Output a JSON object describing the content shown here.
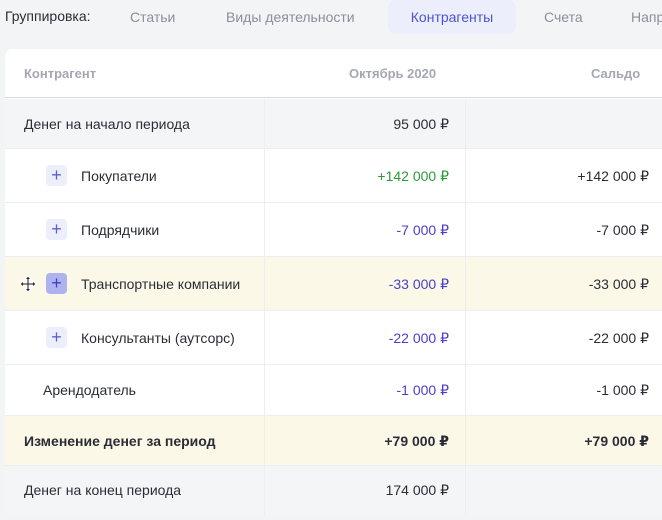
{
  "toolbar": {
    "grouping_label": "Группировка:",
    "tabs": [
      {
        "label": "Статьи",
        "active": false
      },
      {
        "label": "Виды деятельности",
        "active": false
      },
      {
        "label": "Контрагенты",
        "active": true
      },
      {
        "label": "Счета",
        "active": false
      },
      {
        "label": "Напр",
        "active": false
      }
    ]
  },
  "table": {
    "headers": {
      "counterparty": "Контрагент",
      "period": "Октябрь 2020",
      "balance": "Сальдо"
    },
    "rows": [
      {
        "name": "Денег на начало периода",
        "value": "95 000 ₽",
        "balance": ""
      },
      {
        "name": "Покупатели",
        "value": "+142 000 ₽",
        "balance": "+142 000 ₽"
      },
      {
        "name": "Подрядчики",
        "value": "-7 000 ₽",
        "balance": "-7 000 ₽"
      },
      {
        "name": "Транспортные компании",
        "value": "-33 000 ₽",
        "balance": "-33 000 ₽"
      },
      {
        "name": "Консультанты (аутсорс)",
        "value": "-22 000 ₽",
        "balance": "-22 000 ₽"
      },
      {
        "name": "Арендодатель",
        "value": "-1 000 ₽",
        "balance": "-1 000 ₽"
      },
      {
        "name": "Изменение денег за период",
        "value": "+79 000 ₽",
        "balance": "+79 000 ₽"
      },
      {
        "name": "Денег на конец периода",
        "value": "174 000 ₽",
        "balance": ""
      }
    ]
  },
  "colors": {
    "positive": "#2e9a3a",
    "negative": "#4a3fc9",
    "accent": "#4a55d1",
    "highlight_row": "#fcf8e8"
  },
  "icons": {
    "expand": "+",
    "move_cursor": "move-cursor-icon"
  }
}
